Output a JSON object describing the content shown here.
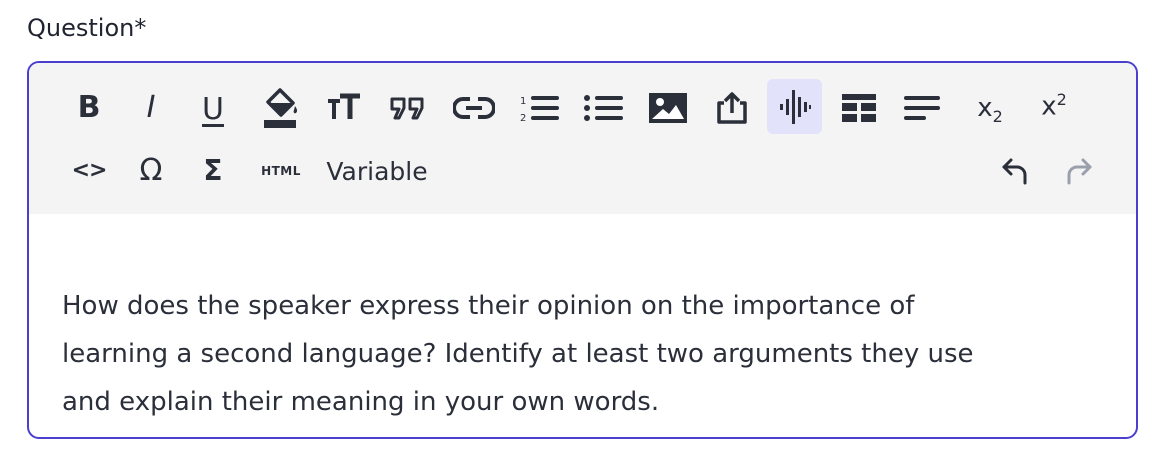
{
  "field": {
    "label": "Question*"
  },
  "toolbar": {
    "row1": [
      {
        "name": "bold-button",
        "icon": "bold-icon",
        "glyph": "B"
      },
      {
        "name": "italic-button",
        "icon": "italic-icon",
        "glyph": "I"
      },
      {
        "name": "underline-button",
        "icon": "underline-icon",
        "glyph": "U"
      },
      {
        "name": "fill-color-button",
        "icon": "paint-bucket-icon"
      },
      {
        "name": "font-size-button",
        "icon": "text-size-icon"
      },
      {
        "name": "blockquote-button",
        "icon": "quote-icon"
      },
      {
        "name": "link-button",
        "icon": "link-icon"
      },
      {
        "name": "ordered-list-button",
        "icon": "ordered-list-icon"
      },
      {
        "name": "bullet-list-button",
        "icon": "bullet-list-icon"
      },
      {
        "name": "image-button",
        "icon": "image-icon"
      },
      {
        "name": "upload-button",
        "icon": "upload-icon"
      },
      {
        "name": "audio-button",
        "icon": "audio-waveform-icon",
        "active": true
      },
      {
        "name": "table-button",
        "icon": "table-icon"
      },
      {
        "name": "align-button",
        "icon": "align-icon"
      },
      {
        "name": "subscript-button",
        "icon": "subscript-icon"
      },
      {
        "name": "superscript-button",
        "icon": "superscript-icon"
      }
    ],
    "row2": [
      {
        "name": "code-view-button",
        "icon": "code-icon",
        "glyph": "<>"
      },
      {
        "name": "special-char-button",
        "icon": "omega-icon",
        "glyph": "Ω"
      },
      {
        "name": "math-button",
        "icon": "sigma-icon",
        "glyph": "Σ"
      },
      {
        "name": "html-button",
        "icon": "html-icon",
        "glyph": "HTML"
      },
      {
        "name": "variable-button",
        "label": "Variable"
      },
      {
        "name": "undo-button",
        "icon": "undo-icon"
      },
      {
        "name": "redo-button",
        "icon": "redo-icon",
        "disabled": true
      }
    ],
    "glyphs": {
      "bold": "B",
      "italic": "I",
      "underline": "U",
      "subscript_base": "x",
      "subscript_index": "2",
      "superscript_base": "x",
      "superscript_index": "2",
      "code": "<>",
      "omega": "Ω",
      "sigma": "Σ",
      "html": "HTML",
      "variable": "Variable"
    },
    "colors": {
      "icon": "#2b2f3a",
      "disabled_icon": "#9aa0ab",
      "active_bg": "#e2e3fb",
      "toolbar_bg": "#f4f4f5",
      "border": "#4a3fcf"
    }
  },
  "content": {
    "lines": [
      "How does the speaker express their opinion on the importance of",
      "learning a second language? Identify at least two arguments they use",
      "and explain their meaning in your own words."
    ]
  }
}
